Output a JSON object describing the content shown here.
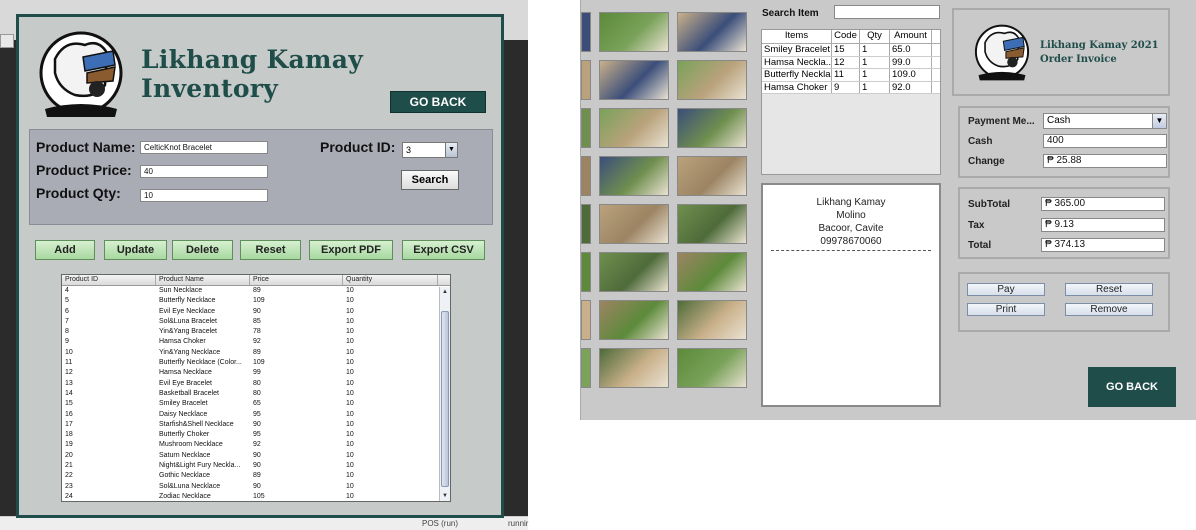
{
  "inventory": {
    "title": "Likhang Kamay Inventory",
    "go_back_label": "GO BACK",
    "form": {
      "product_name_label": "Product Name:",
      "product_name_value": "CelticKnot Bracelet",
      "product_price_label": "Product Price:",
      "product_price_value": "40",
      "product_qty_label": "Product Qty:",
      "product_qty_value": "10",
      "product_id_label": "Product ID:",
      "product_id_value": "3",
      "search_label": "Search"
    },
    "actions": {
      "add": "Add",
      "update": "Update",
      "delete": "Delete",
      "reset": "Reset",
      "export_pdf": "Export PDF",
      "export_csv": "Export CSV"
    },
    "table": {
      "columns": [
        "Product ID",
        "Product Name",
        "Price",
        "Quantity"
      ],
      "rows": [
        [
          "4",
          "Sun Necklace",
          "89",
          "10"
        ],
        [
          "5",
          "Butterfly Necklace",
          "109",
          "10"
        ],
        [
          "6",
          "Evil Eye Necklace",
          "90",
          "10"
        ],
        [
          "7",
          "Sol&Luna Bracelet",
          "85",
          "10"
        ],
        [
          "8",
          "Yin&Yang Bracelet",
          "78",
          "10"
        ],
        [
          "9",
          "Hamsa Choker",
          "92",
          "10"
        ],
        [
          "10",
          "Yin&Yang Necklace",
          "89",
          "10"
        ],
        [
          "11",
          "Butterfly Necklace (Color...",
          "109",
          "10"
        ],
        [
          "12",
          "Hamsa Necklace",
          "99",
          "10"
        ],
        [
          "13",
          "Evil Eye Bracelet",
          "80",
          "10"
        ],
        [
          "14",
          "Basketball Bracelet",
          "80",
          "10"
        ],
        [
          "15",
          "Smiley Bracelet",
          "65",
          "10"
        ],
        [
          "16",
          "Daisy Necklace",
          "95",
          "10"
        ],
        [
          "17",
          "Starfish&Shell Necklace",
          "90",
          "10"
        ],
        [
          "18",
          "Butterfly Choker",
          "95",
          "10"
        ],
        [
          "19",
          "Mushroom Necklace",
          "92",
          "10"
        ],
        [
          "20",
          "Saturn Necklace",
          "90",
          "10"
        ],
        [
          "21",
          "Night&Light Fury Neckla...",
          "90",
          "10"
        ],
        [
          "22",
          "Gothic Necklace",
          "89",
          "10"
        ],
        [
          "23",
          "Sol&Luna Necklace",
          "90",
          "10"
        ],
        [
          "24",
          "Zodiac Necklace",
          "105",
          "10"
        ]
      ]
    },
    "ide_status": "POS (run)",
    "ide_status_right": "runnir"
  },
  "pos": {
    "search_label": "Search Item",
    "search_value": "",
    "items_table": {
      "columns": [
        "Items",
        "Code",
        "Qty",
        "Amount"
      ],
      "rows": [
        [
          "Smiley Bracelet",
          "15",
          "1",
          "65.0"
        ],
        [
          "Hamsa Neckla...",
          "12",
          "1",
          "99.0"
        ],
        [
          "Butterfly Neckla...",
          "11",
          "1",
          "109.0"
        ],
        [
          "Hamsa Choker",
          "9",
          "1",
          "92.0"
        ]
      ]
    },
    "receipt": {
      "line1": "Likhang Kamay",
      "line2": "Molino",
      "line3": "Bacoor, Cavite",
      "line4": "09978670060"
    },
    "invoice_title_line1": "Likhang Kamay 2021",
    "invoice_title_line2": "Order Invoice",
    "payment": {
      "method_label": "Payment Me...",
      "method_value": "Cash",
      "cash_label": "Cash",
      "cash_value": "400",
      "change_label": "Change",
      "change_value": "₱ 25.88"
    },
    "totals": {
      "subtotal_label": "SubTotal",
      "subtotal_value": "₱ 365.00",
      "tax_label": "Tax",
      "tax_value": "₱ 9.13",
      "total_label": "Total",
      "total_value": "₱ 374.13"
    },
    "buttons": {
      "pay": "Pay",
      "reset": "Reset",
      "print": "Print",
      "remove": "Remove",
      "go_back": "GO BACK"
    }
  },
  "colors": {
    "brand_teal": "#1f4d4a",
    "action_green": "#a8d8a0"
  }
}
